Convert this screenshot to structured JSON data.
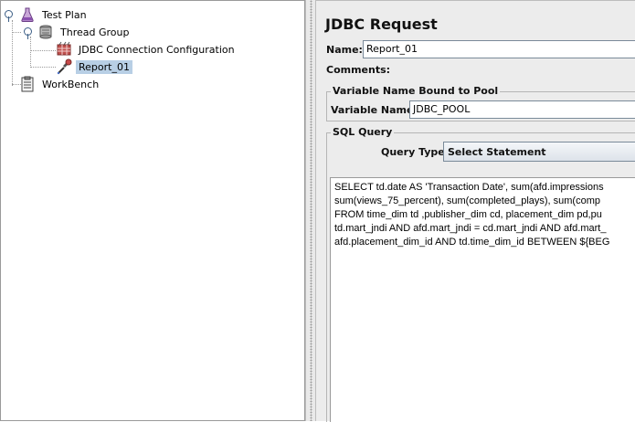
{
  "tree": {
    "items": [
      {
        "label": "Test Plan"
      },
      {
        "label": "Thread Group"
      },
      {
        "label": "JDBC Connection Configuration"
      },
      {
        "label": "Report_01",
        "selected": true
      },
      {
        "label": "WorkBench"
      }
    ]
  },
  "panel": {
    "title": "JDBC Request",
    "name_label": "Name:",
    "name_value": "Report_01",
    "comments_label": "Comments:",
    "comments_value": ""
  },
  "pool_group": {
    "title": "Variable Name Bound to Pool",
    "var_label": "Variable Name:",
    "var_value": "JDBC_POOL"
  },
  "sql_group": {
    "title": "SQL Query",
    "query_type_label": "Query Type:",
    "query_type_value": "Select Statement",
    "query_lines": [
      "SELECT td.date AS 'Transaction Date', sum(afd.impressions",
      "sum(views_75_percent), sum(completed_plays), sum(comp",
      "FROM  time_dim td ,publisher_dim cd, placement_dim pd,pu",
      "td.mart_jndi AND afd.mart_jndi = cd.mart_jndi AND afd.mart_",
      "afd.placement_dim_id AND td.time_dim_id BETWEEN ${BEG"
    ]
  },
  "colors": {
    "selection": "#b8cfe5",
    "pane_bg": "#ececec",
    "tree_bg": "#ffffff"
  }
}
